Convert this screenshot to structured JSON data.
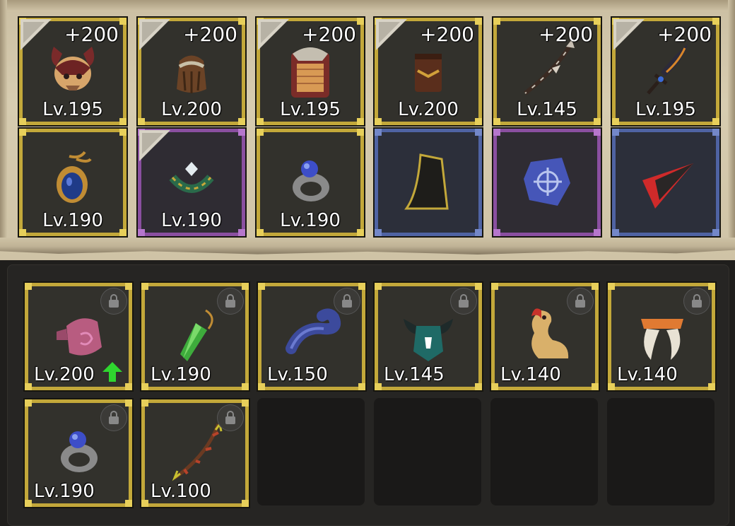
{
  "equipped": [
    {
      "name": "horned-helmet-icon",
      "level": "Lv.195",
      "bonus": "+200",
      "frame": "gold",
      "star": true
    },
    {
      "name": "bracer-icon",
      "level": "Lv.200",
      "bonus": "+200",
      "frame": "gold",
      "star": true
    },
    {
      "name": "chest-armor-icon",
      "level": "Lv.195",
      "bonus": "+200",
      "frame": "gold",
      "star": true
    },
    {
      "name": "leg-armor-icon",
      "level": "Lv.200",
      "bonus": "+200",
      "frame": "gold",
      "star": true
    },
    {
      "name": "bow-icon",
      "level": "Lv.145",
      "bonus": "+200",
      "frame": "gold",
      "star": false
    },
    {
      "name": "dagger-icon",
      "level": "Lv.195",
      "bonus": "+200",
      "frame": "gold",
      "star": true
    },
    {
      "name": "amulet-icon",
      "level": "Lv.190",
      "bonus": "",
      "frame": "gold",
      "star": false
    },
    {
      "name": "necklace-icon",
      "level": "Lv.190",
      "bonus": "",
      "frame": "purple",
      "star": true
    },
    {
      "name": "ring-icon",
      "level": "Lv.190",
      "bonus": "",
      "frame": "gold",
      "star": false
    },
    {
      "name": "cape-icon",
      "level": "",
      "bonus": "",
      "frame": "blue",
      "star": false
    },
    {
      "name": "rune-stone-icon",
      "level": "",
      "bonus": "",
      "frame": "purple",
      "star": false
    },
    {
      "name": "arrowhead-icon",
      "level": "",
      "bonus": "",
      "frame": "blue",
      "star": false
    }
  ],
  "inventory": [
    {
      "name": "gauntlet-icon",
      "level": "Lv.200",
      "locked": true,
      "upgrade": true
    },
    {
      "name": "pendulum-icon",
      "level": "Lv.190",
      "locked": true,
      "upgrade": false
    },
    {
      "name": "horn-icon",
      "level": "Lv.150",
      "locked": true,
      "upgrade": false
    },
    {
      "name": "horned-mask-icon",
      "level": "Lv.145",
      "locked": true,
      "upgrade": false
    },
    {
      "name": "dragon-icon",
      "level": "Lv.140",
      "locked": true,
      "upgrade": false
    },
    {
      "name": "claws-icon",
      "level": "Lv.140",
      "locked": true,
      "upgrade": false
    },
    {
      "name": "ring-icon",
      "level": "Lv.190",
      "locked": true,
      "upgrade": false
    },
    {
      "name": "thorn-bow-icon",
      "level": "Lv.100",
      "locked": true,
      "upgrade": false
    }
  ],
  "colors": {
    "gold": "#c3a83a",
    "purple": "#8a4fa0",
    "blue": "#4f63a3",
    "upgrade": "#2fd62f"
  }
}
